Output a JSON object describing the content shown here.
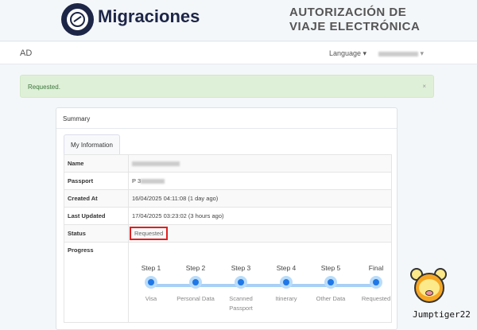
{
  "header": {
    "brand": "Migraciones",
    "title_line1": "AUTORIZACIÓN DE",
    "title_line2": "VIAJE ELECTRÓNICA"
  },
  "nav": {
    "home": "AD",
    "language": "Language ▾",
    "user_caret": "▾"
  },
  "alert": {
    "message": "Requested.",
    "close": "×"
  },
  "panel": {
    "title": "Summary",
    "tab": "My Information"
  },
  "rows": [
    {
      "label": "Name",
      "value": ""
    },
    {
      "label": "Passport",
      "value": "P 3"
    },
    {
      "label": "Created At",
      "value": "16/04/2025 04:11:08 (1 day ago)"
    },
    {
      "label": "Last Updated",
      "value": "17/04/2025 03:23:02 (3 hours ago)"
    },
    {
      "label": "Status",
      "value": "Requested"
    },
    {
      "label": "Progress",
      "value": ""
    }
  ],
  "steps": [
    {
      "title": "Step 1",
      "label": "Visa"
    },
    {
      "title": "Step 2",
      "label": "Personal Data"
    },
    {
      "title": "Step 3",
      "label": "Scanned Passport"
    },
    {
      "title": "Step 4",
      "label": "Itinerary"
    },
    {
      "title": "Step 5",
      "label": "Other Data"
    },
    {
      "title": "Final",
      "label": "Requested"
    }
  ],
  "watermark": {
    "text": "Jumptiger22"
  }
}
